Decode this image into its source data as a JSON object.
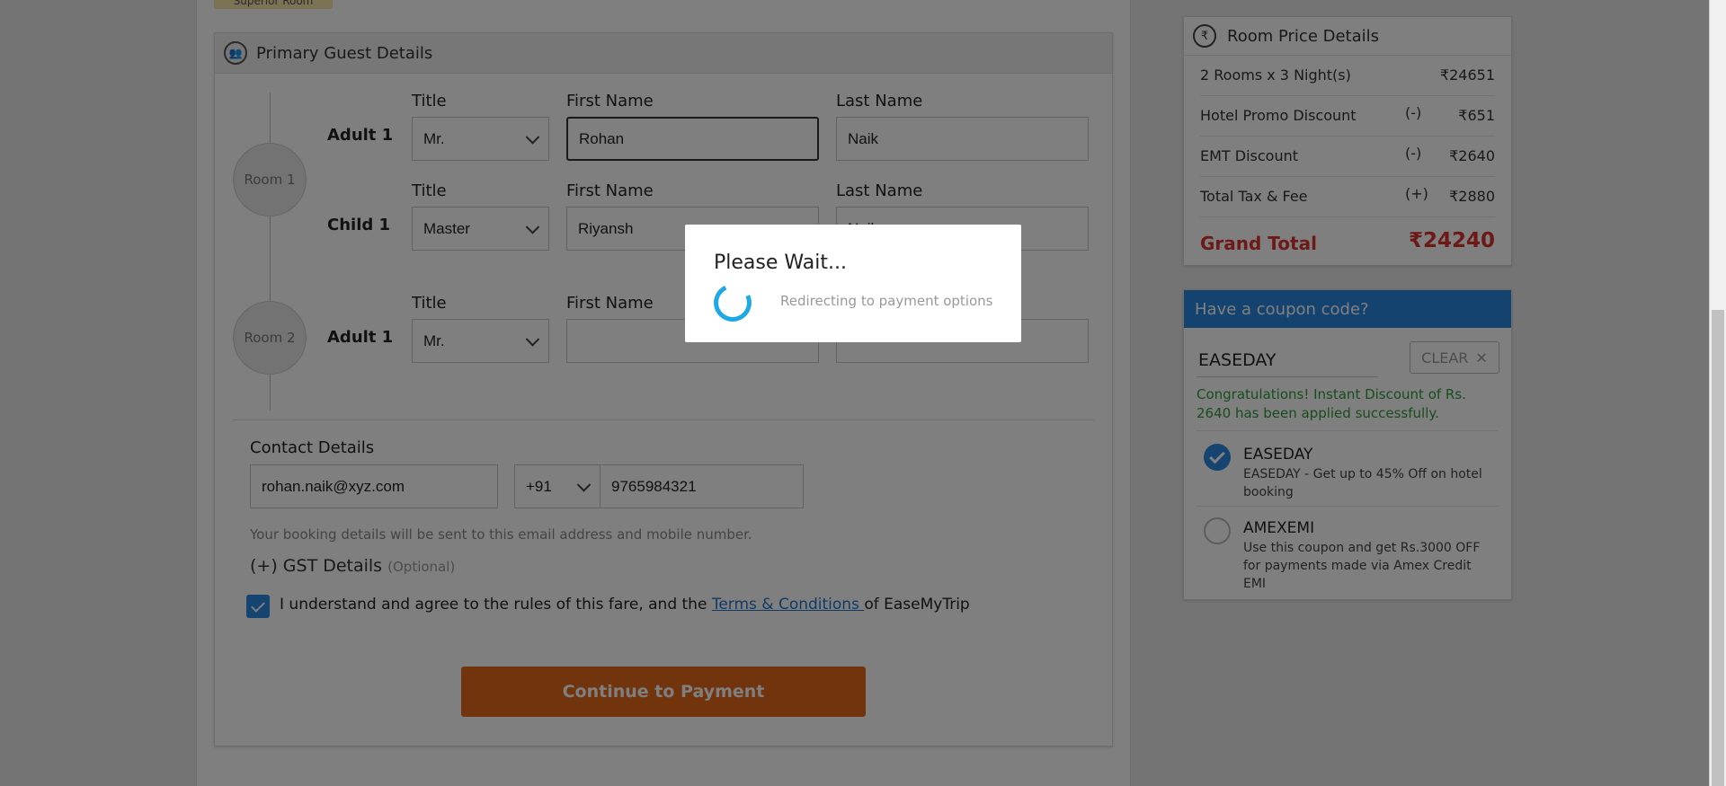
{
  "room_tag": "Superior Room",
  "guest": {
    "title": "Primary Guest Details",
    "header_icon": "guest-icon",
    "col_title": "Title",
    "col_first": "First Name",
    "col_last": "Last Name",
    "rooms": [
      {
        "label": "Room 1",
        "guests": [
          {
            "type": "Adult 1",
            "title": "Mr.",
            "first": "Rohan",
            "last": "Naik"
          },
          {
            "type": "Child 1",
            "title": "Master",
            "first": "Riyansh",
            "last": "Naik"
          }
        ]
      },
      {
        "label": "Room 2",
        "guests": [
          {
            "type": "Adult 1",
            "title": "Mr.",
            "first": "",
            "last": ""
          }
        ]
      }
    ]
  },
  "contact": {
    "heading": "Contact Details",
    "email": "rohan.naik@xyz.com",
    "country_code": "+91",
    "phone": "9765984321",
    "note": "Your booking details will be sent to this email address and mobile number."
  },
  "gst": {
    "label": "(+) GST Details",
    "optional": "(Optional)"
  },
  "agreement": {
    "checked": true,
    "text_before": "I understand and agree to the rules of this fare, and the ",
    "link": "Terms & Conditions ",
    "text_after": "of EaseMyTrip"
  },
  "cta": {
    "label": "Continue to Payment",
    "color": "#e3691a"
  },
  "price": {
    "title": "Room Price Details",
    "rows": [
      {
        "label": "2 Rooms x 3 Night(s)",
        "sign": "",
        "value": "₹24651"
      },
      {
        "label": "Hotel Promo Discount",
        "sign": "(-)",
        "value": "₹651"
      },
      {
        "label": "EMT Discount",
        "sign": "(-)",
        "value": "₹2640"
      },
      {
        "label": "Total Tax & Fee",
        "sign": "(+)",
        "value": "₹2880"
      }
    ],
    "grand_label": "Grand Total",
    "grand_value": "₹24240",
    "grand_color": "#d9322f"
  },
  "coupon": {
    "header": "Have a coupon code?",
    "header_color": "#2b87df",
    "input_value": "EASEDAY",
    "clear_label": "CLEAR",
    "success": "Congratulations! Instant Discount of Rs. 2640 has been applied successfully.",
    "options": [
      {
        "code": "EASEDAY",
        "desc": "EASEDAY - Get up to 45% Off on hotel booking",
        "selected": true
      },
      {
        "code": "AMEXEMI",
        "desc": "Use this coupon and get Rs.3000 OFF for payments made via Amex Credit EMI",
        "selected": false
      }
    ]
  },
  "modal": {
    "title": "Please Wait...",
    "message": "Redirecting to payment options",
    "spinner_color": "#1fa8e6"
  }
}
